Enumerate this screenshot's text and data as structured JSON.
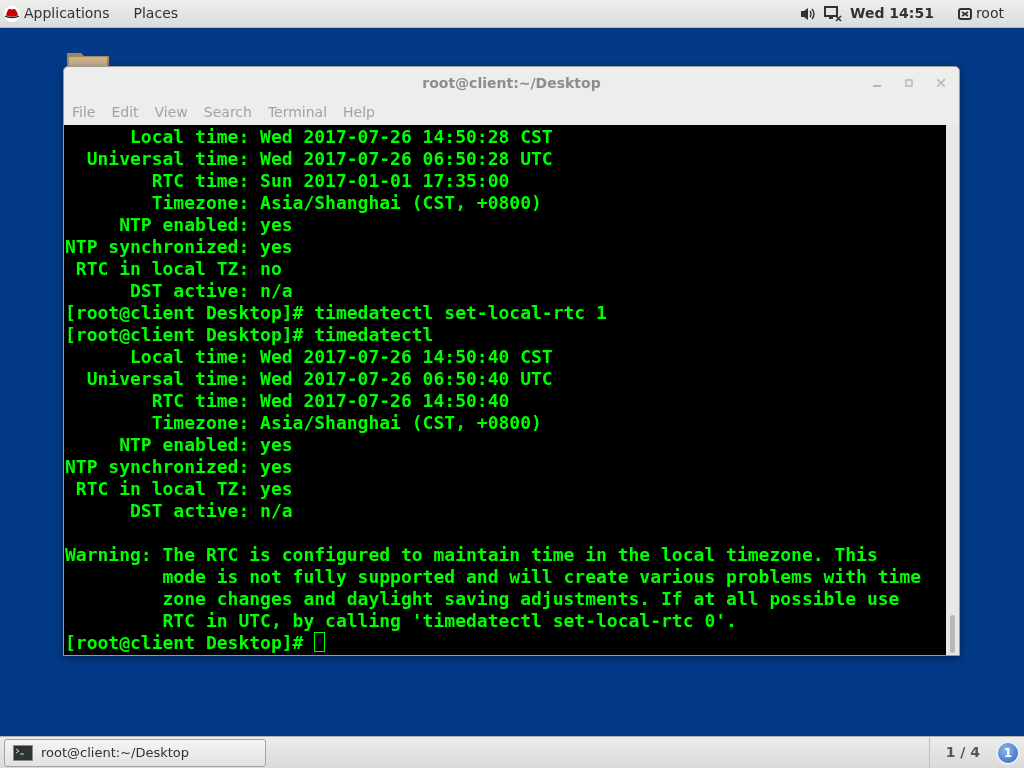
{
  "top_bar": {
    "menus": [
      "Applications",
      "Places"
    ],
    "clock": "Wed 14:51",
    "user": "root"
  },
  "window": {
    "title": "root@client:~/Desktop",
    "menu": [
      "File",
      "Edit",
      "View",
      "Search",
      "Terminal",
      "Help"
    ],
    "terminal_lines": [
      {
        "kind": "output",
        "text": "      Local time: Wed 2017-07-26 14:50:28 CST"
      },
      {
        "kind": "output",
        "text": "  Universal time: Wed 2017-07-26 06:50:28 UTC"
      },
      {
        "kind": "output",
        "text": "        RTC time: Sun 2017-01-01 17:35:00"
      },
      {
        "kind": "output",
        "text": "        Timezone: Asia/Shanghai (CST, +0800)"
      },
      {
        "kind": "output",
        "text": "     NTP enabled: yes"
      },
      {
        "kind": "output",
        "text": "NTP synchronized: yes"
      },
      {
        "kind": "output",
        "text": " RTC in local TZ: no"
      },
      {
        "kind": "output",
        "text": "      DST active: n/a"
      },
      {
        "kind": "command",
        "text": "[root@client Desktop]# timedatectl set-local-rtc 1"
      },
      {
        "kind": "command",
        "text": "[root@client Desktop]# timedatectl"
      },
      {
        "kind": "output",
        "text": "      Local time: Wed 2017-07-26 14:50:40 CST"
      },
      {
        "kind": "output",
        "text": "  Universal time: Wed 2017-07-26 06:50:40 UTC"
      },
      {
        "kind": "output",
        "text": "        RTC time: Wed 2017-07-26 14:50:40"
      },
      {
        "kind": "output",
        "text": "        Timezone: Asia/Shanghai (CST, +0800)"
      },
      {
        "kind": "output",
        "text": "     NTP enabled: yes"
      },
      {
        "kind": "output",
        "text": "NTP synchronized: yes"
      },
      {
        "kind": "output",
        "text": " RTC in local TZ: yes"
      },
      {
        "kind": "output",
        "text": "      DST active: n/a"
      },
      {
        "kind": "blank"
      },
      {
        "kind": "output",
        "text": "Warning: The RTC is configured to maintain time in the local timezone. This"
      },
      {
        "kind": "output",
        "text": "         mode is not fully supported and will create various problems with time"
      },
      {
        "kind": "output",
        "text": "         zone changes and daylight saving adjustments. If at all possible use"
      },
      {
        "kind": "output",
        "text": "         RTC in UTC, by calling 'timedatectl set-local-rtc 0'."
      },
      {
        "kind": "prompt",
        "text": "[root@client Desktop]#"
      }
    ]
  },
  "taskbar": {
    "task": "root@client:~/Desktop",
    "workspace": "1 / 4",
    "notifications": "1"
  }
}
